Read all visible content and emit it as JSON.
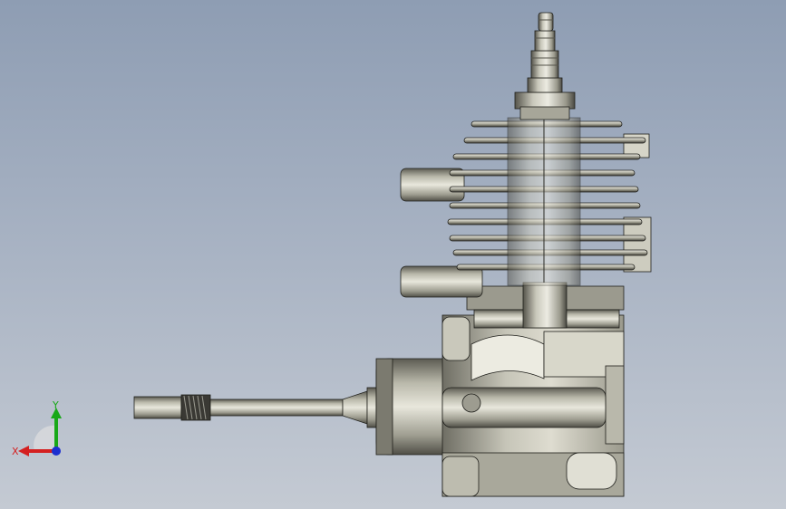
{
  "viewport": {
    "model": "engine-assembly",
    "background_top": "#8e9db3",
    "background_bottom": "#c4cad3"
  },
  "triad": {
    "x_label": "X",
    "y_label": "Y",
    "x_color": "#d42020",
    "y_color": "#18a818",
    "z_color": "#1c2fd0"
  }
}
